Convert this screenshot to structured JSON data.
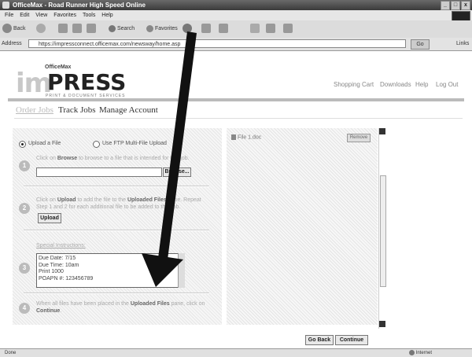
{
  "window": {
    "title": "OfficeMax - Road Runner High Speed Online",
    "controls": [
      "_",
      "□",
      "x"
    ]
  },
  "menu": [
    "File",
    "Edit",
    "View",
    "Favorites",
    "Tools",
    "Help"
  ],
  "toolbar": {
    "back": "Back",
    "search": "Search",
    "favorites": "Favorites"
  },
  "address": {
    "label": "Address",
    "url": "https://impressconnect.officemax.com/newsway/home.asp",
    "go": "Go",
    "links": "Links"
  },
  "logo": {
    "brand_small": "OfficeMax",
    "im": "im",
    "press": "PRESS",
    "tagline": "PRINT & DOCUMENT SERVICES"
  },
  "top_nav": [
    "Shopping Cart",
    "Downloads",
    "Help",
    "Log Out"
  ],
  "tabs": {
    "order": "Order Jobs",
    "track": "Track Jobs",
    "manage": "Manage Account"
  },
  "upload": {
    "radio_file": "Upload a File",
    "radio_ftp": "Use FTP Multi-File Upload",
    "step1_pre": "Click on ",
    "step1_bold": "Browse",
    "step1_post": " to browse to a file that is intended for this job.",
    "browse_btn": "Browse...",
    "step2_pre": "Click on ",
    "step2_bold": "Upload",
    "step2_mid": " to add the file to the ",
    "step2_bold2": "Uploaded Files",
    "step2_post": " pane. Repeat Step 1 and 2 for each additional file to be added to the Job.",
    "upload_btn": "Upload",
    "special_label": "Special Instructions:",
    "special_lines": [
      "Due Date: 7/15",
      "Due Time: 10am",
      "Print 1000",
      "POAPN #: 123456789"
    ],
    "step4_pre": "When all files have been placed in the ",
    "step4_bold": "Uploaded Files",
    "step4_mid": " pane, click on ",
    "step4_bold2": "Continue",
    "step4_post": "."
  },
  "steps": [
    "1",
    "2",
    "3",
    "4"
  ],
  "uploaded": {
    "file": "File 1.doc",
    "remove": "Remove"
  },
  "buttons": {
    "go_back": "Go Back",
    "continue": "Continue"
  },
  "status": {
    "left": "Done",
    "zone": "Internet"
  }
}
